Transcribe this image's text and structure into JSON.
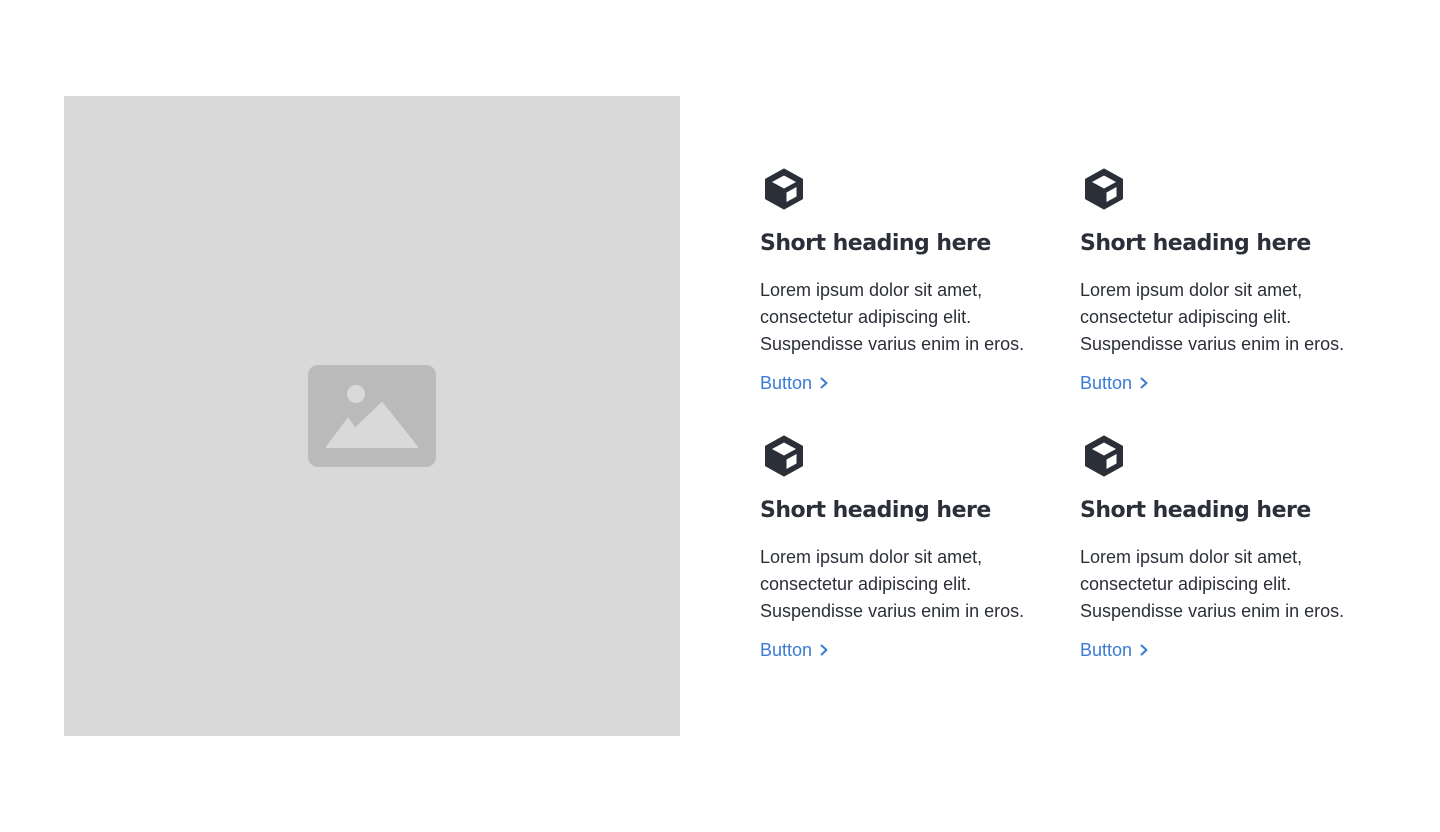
{
  "image": {
    "icon": "image-icon"
  },
  "features": [
    {
      "icon": "cube-icon",
      "heading": "Short heading here",
      "body": "Lorem ipsum dolor sit amet, consectetur adipiscing elit. Suspendisse varius enim in eros.",
      "button_label": "Button",
      "button_icon": "chevron-right-icon"
    },
    {
      "icon": "cube-icon",
      "heading": "Short heading here",
      "body": "Lorem ipsum dolor sit amet, consectetur adipiscing elit. Suspendisse varius enim in eros.",
      "button_label": "Button",
      "button_icon": "chevron-right-icon"
    },
    {
      "icon": "cube-icon",
      "heading": "Short heading here",
      "body": "Lorem ipsum dolor sit amet, consectetur adipiscing elit. Suspendisse varius enim in eros.",
      "button_label": "Button",
      "button_icon": "chevron-right-icon"
    },
    {
      "icon": "cube-icon",
      "heading": "Short heading here",
      "body": "Lorem ipsum dolor sit amet, consectetur adipiscing elit. Suspendisse varius enim in eros.",
      "button_label": "Button",
      "button_icon": "chevron-right-icon"
    }
  ],
  "colors": {
    "text": "#2b2f38",
    "link": "#3a7bd5",
    "placeholder_bg": "#d9d9d9",
    "placeholder_icon": "#bababa"
  }
}
